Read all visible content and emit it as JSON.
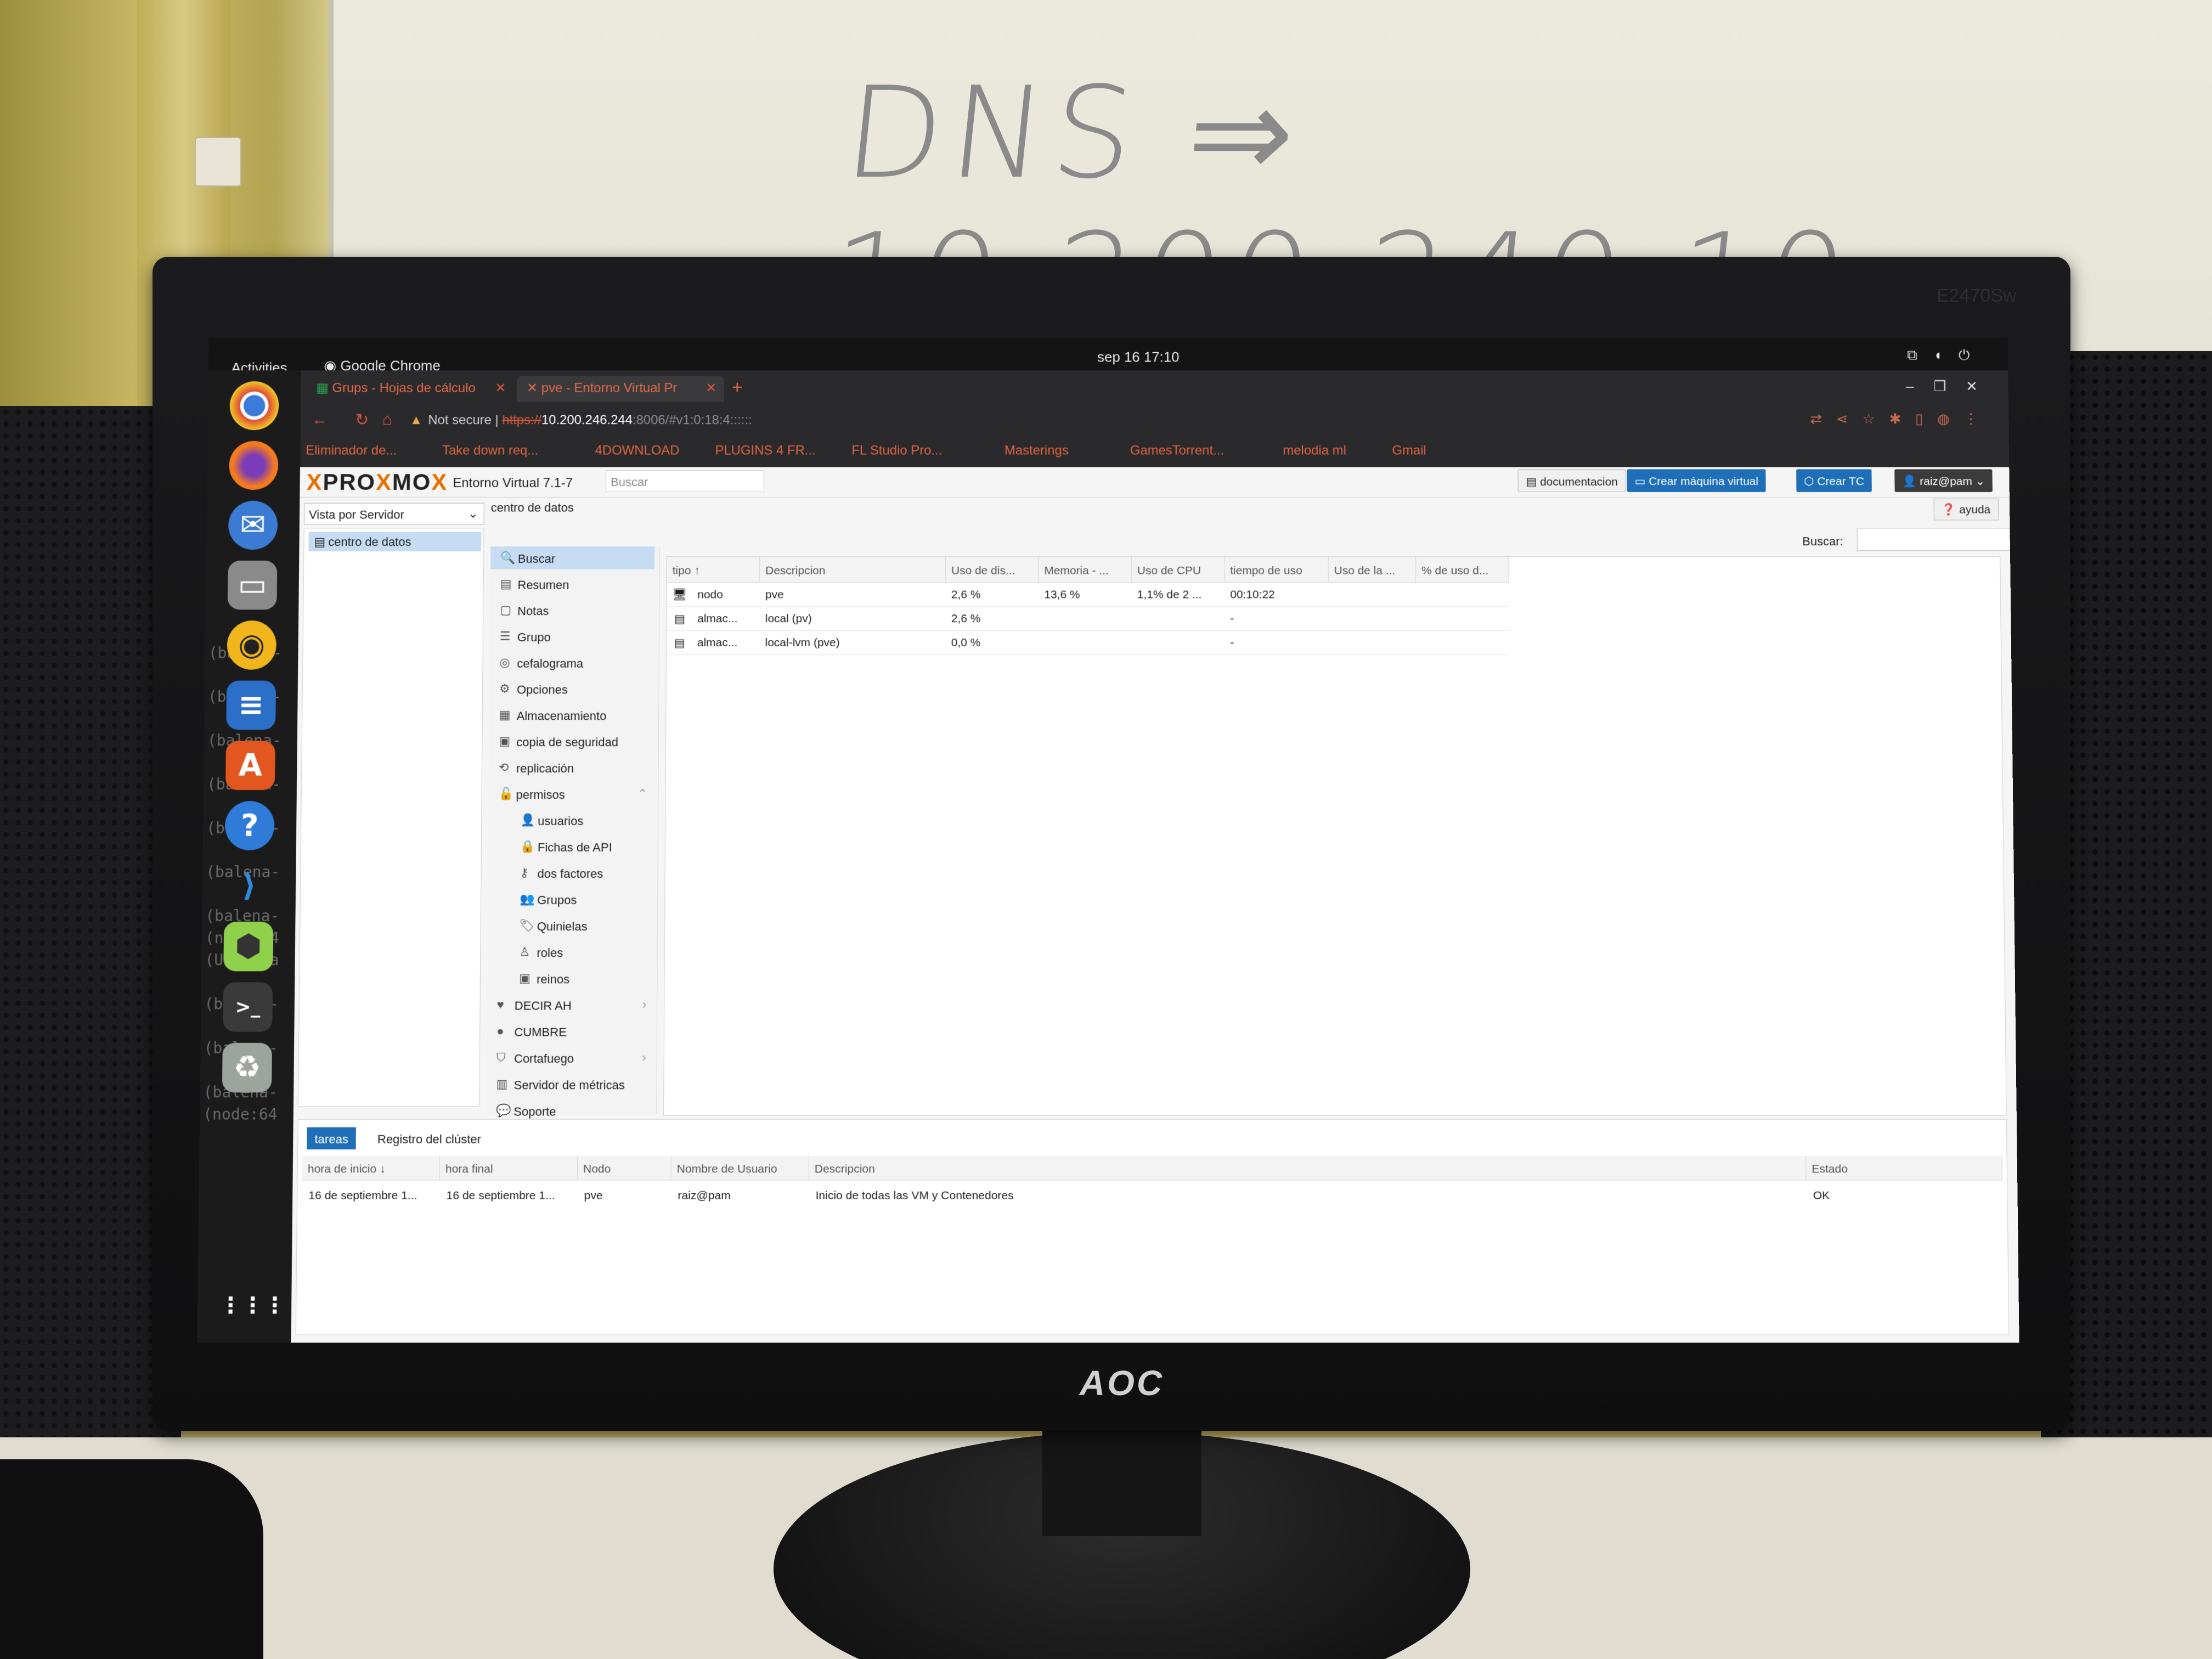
{
  "scene": {
    "whiteboard_text": "DNS ⇒ 10.200.240.10",
    "monitor_brand": "AOC",
    "monitor_model": "E2470Sw"
  },
  "desktop": {
    "activities": "Activities",
    "active_app": "Google Chrome",
    "clock": "sep 16  17:10",
    "dock_bg_text": "(balena-\n\n(balena-\n\n(balena-\n\n(balena-\n\n(balena-\n\n(balena-\n\n(balena-\n(node:64\n(Use `ba\n\n(balena-\n\n(balena-\n\n(balena-\n(node:64"
  },
  "browser": {
    "tabs": [
      {
        "label": "Grups - Hojas de cálculo"
      },
      {
        "label": "pve - Entorno Virtual Pr"
      }
    ],
    "address": {
      "warning": "Not secure",
      "scheme": "https://",
      "host": "10.200.246.244",
      "rest": ":8006/#v1:0:18:4::::::"
    },
    "bookmarks": [
      "Eliminador de...",
      "Take down req...",
      "4DOWNLOAD",
      "PLUGINS 4 FR...",
      "FL Studio Pro...",
      "Masterings",
      "GamesTorrent...",
      "melodia ml",
      "Gmail"
    ]
  },
  "proxmox": {
    "logo_left": "PRO",
    "logo_mid": "MO",
    "version": "Entorno Virtual 7.1-7",
    "top_search_placeholder": "Buscar",
    "header_buttons": {
      "docs": "documentacion",
      "create_vm": "Crear máquina virtual",
      "create_ct": "Crear TC",
      "user": "raiz@pam"
    },
    "view_selector": "Vista por Servidor",
    "tree_root": "centro de datos",
    "breadcrumb": "centro de datos",
    "help": "ayuda",
    "search_label": "Buscar:",
    "menu": [
      {
        "label": "Buscar",
        "icon": "🔍",
        "active": true,
        "sub": false
      },
      {
        "label": "Resumen",
        "icon": "▤",
        "sub": false
      },
      {
        "label": "Notas",
        "icon": "▢",
        "sub": false
      },
      {
        "label": "Grupo",
        "icon": "☰",
        "sub": false
      },
      {
        "label": "cefalograma",
        "icon": "◎",
        "sub": false
      },
      {
        "label": "Opciones",
        "icon": "⚙",
        "sub": false
      },
      {
        "label": "Almacenamiento",
        "icon": "▦",
        "sub": false
      },
      {
        "label": "copia de seguridad",
        "icon": "▣",
        "sub": false
      },
      {
        "label": "replicación",
        "icon": "⟲",
        "sub": false
      },
      {
        "label": "permisos",
        "icon": "🔓",
        "sub": false
      },
      {
        "label": "usuarios",
        "icon": "👤",
        "sub": true
      },
      {
        "label": "Fichas de API",
        "icon": "🔒",
        "sub": true
      },
      {
        "label": "dos factores",
        "icon": "⚷",
        "sub": true
      },
      {
        "label": "Grupos",
        "icon": "👥",
        "sub": true
      },
      {
        "label": "Quinielas",
        "icon": "🏷",
        "sub": true
      },
      {
        "label": "roles",
        "icon": "♙",
        "sub": true
      },
      {
        "label": "reinos",
        "icon": "▣",
        "sub": true
      },
      {
        "label": "DECIR AH",
        "icon": "♥",
        "sub": false
      },
      {
        "label": "CUMBRE",
        "icon": "●",
        "sub": false
      },
      {
        "label": "Cortafuego",
        "icon": "⛉",
        "sub": false
      },
      {
        "label": "Servidor de métricas",
        "icon": "▥",
        "sub": false
      },
      {
        "label": "Soporte",
        "icon": "💬",
        "sub": false
      }
    ],
    "grid_headers": [
      "tipo ↑",
      "Descripcion",
      "Uso de dis...",
      "Memoria - ...",
      "Uso de CPU",
      "tiempo de uso",
      "Uso de la ...",
      "% de uso d..."
    ],
    "grid_rows": [
      {
        "tipo": "nodo",
        "descripcion": "pve",
        "disco": "2,6 %",
        "memoria": "13,6 %",
        "cpu": "1,1% de 2 ...",
        "tiempo": "00:10:22"
      },
      {
        "tipo": "almac...",
        "descripcion": "local (pv)",
        "disco": "2,6 %",
        "memoria": "",
        "cpu": "",
        "tiempo": "-"
      },
      {
        "tipo": "almac...",
        "descripcion": "local-lvm (pve)",
        "disco": "0,0 %",
        "memoria": "",
        "cpu": "",
        "tiempo": "-"
      }
    ],
    "bottom_tabs": [
      "tareas",
      "Registro del clúster"
    ],
    "task_headers": [
      "hora de inicio ↓",
      "hora final",
      "Nodo",
      "Nombre de Usuario",
      "Descripcion",
      "Estado"
    ],
    "task_row": {
      "start": "16 de septiembre 1...",
      "end": "16 de septiembre 1...",
      "node": "pve",
      "user": "raiz@pam",
      "desc": "Inicio de todas las VM y Contenedores",
      "status": "OK"
    }
  }
}
